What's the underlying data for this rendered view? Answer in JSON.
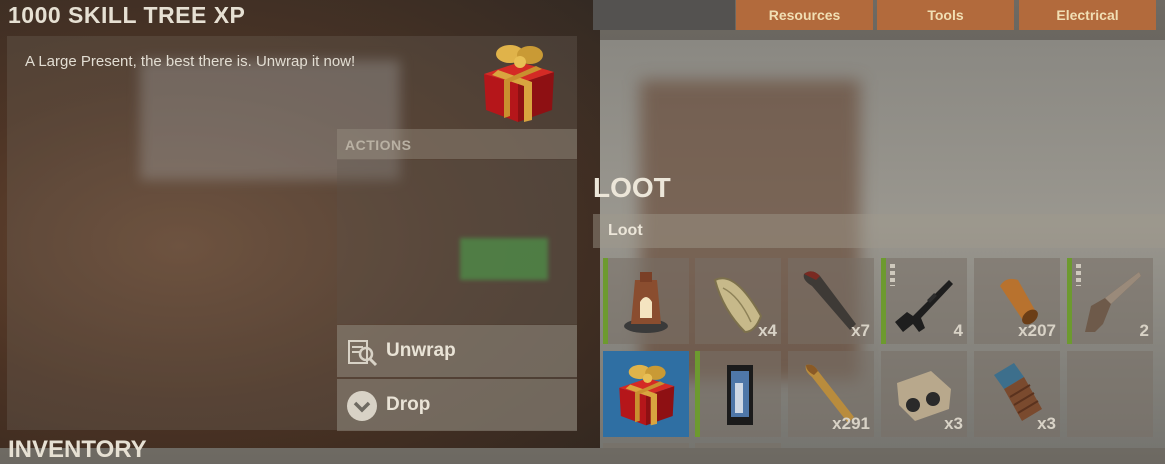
{
  "item_panel": {
    "title": "1000 SKILL TREE XP",
    "description": "A Large Present, the best there is. Unwrap it now!",
    "icon": "large-present-icon"
  },
  "actions": {
    "header": "ACTIONS",
    "buttons": [
      {
        "label": "Unwrap",
        "icon": "unwrap-icon"
      },
      {
        "label": "Drop",
        "icon": "drop-chevron-icon"
      }
    ]
  },
  "inventory": {
    "title": "INVENTORY"
  },
  "crafting_tabs": [
    "Resources",
    "Tools",
    "Electrical"
  ],
  "loot": {
    "title": "LOOT",
    "container_label": "Loot",
    "slots": [
      {
        "item": "furnace-icon",
        "qty": "",
        "condition_bar": true,
        "selected": false
      },
      {
        "item": "sack-icon",
        "qty": "x4",
        "condition_bar": false,
        "selected": false
      },
      {
        "item": "rocket-icon",
        "qty": "x7",
        "condition_bar": false,
        "selected": false
      },
      {
        "item": "assault-rifle-icon",
        "qty": "4",
        "condition_bar": true,
        "selected": false
      },
      {
        "item": "ammo-icon",
        "qty": "x207",
        "condition_bar": false,
        "selected": false
      },
      {
        "item": "shotgun-icon",
        "qty": "2",
        "condition_bar": true,
        "selected": false
      },
      {
        "item": "large-present-icon",
        "qty": "",
        "condition_bar": false,
        "selected": true
      },
      {
        "item": "battery-icon",
        "qty": "",
        "condition_bar": true,
        "selected": false
      },
      {
        "item": "rifle-bullet-icon",
        "qty": "x291",
        "condition_bar": false,
        "selected": false
      },
      {
        "item": "binoculars-icon",
        "qty": "x3",
        "condition_bar": false,
        "selected": false
      },
      {
        "item": "chocolate-bar-icon",
        "qty": "x3",
        "condition_bar": false,
        "selected": false
      },
      {
        "item": "empty-slot",
        "qty": "",
        "condition_bar": false,
        "selected": false
      }
    ]
  },
  "colors": {
    "tab_bg": "#b26a3c",
    "tab_text": "#f1dfb4",
    "condition_green": "#6d9a2f",
    "selected_slot": "#2f6fa3"
  }
}
